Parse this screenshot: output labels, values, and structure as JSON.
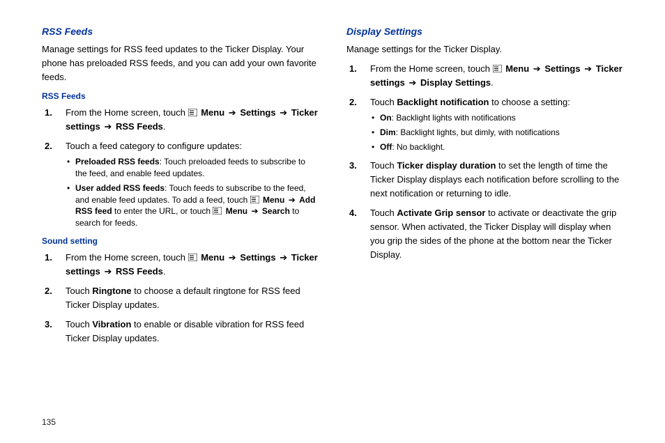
{
  "pageNumber": "135",
  "arrow": "➔",
  "left": {
    "title": "RSS Feeds",
    "intro": "Manage settings for RSS feed updates to the Ticker Display. Your phone has preloaded RSS feeds, and you can add your own favorite feeds.",
    "sub1Title": "RSS Feeds",
    "s1": {
      "num": "1.",
      "pre": "From the Home screen, touch ",
      "path": [
        "Menu",
        "Settings",
        "Ticker settings",
        "RSS Feeds"
      ],
      "dot": "."
    },
    "s2": {
      "num": "2.",
      "text": "Touch a feed category to configure updates:",
      "b1": {
        "bold": "Preloaded RSS feeds",
        "rest": ": Touch preloaded feeds to subscribe to the feed, and enable feed updates."
      },
      "b2": {
        "bold": "User added RSS feeds",
        "t1": ": Touch feeds to subscribe to the feed, and enable feed updates. To add a feed, touch ",
        "p1": [
          "Menu",
          "Add RSS feed"
        ],
        "t2": " to enter the URL, or touch ",
        "p2": [
          "Menu",
          "Search"
        ],
        "t3": " to search for feeds."
      }
    },
    "sub2Title": "Sound setting",
    "ss1": {
      "num": "1.",
      "pre": "From the Home screen, touch ",
      "path": [
        "Menu",
        "Settings",
        "Ticker settings",
        "RSS Feeds"
      ],
      "dot": "."
    },
    "ss2": {
      "num": "2.",
      "t1": "Touch ",
      "b": "Ringtone",
      "t2": " to choose a default ringtone for RSS feed Ticker Display updates."
    },
    "ss3": {
      "num": "3.",
      "t1": "Touch ",
      "b": "Vibration",
      "t2": " to enable or disable vibration for RSS feed Ticker Display updates."
    }
  },
  "right": {
    "title": "Display Settings",
    "intro": "Manage settings for the Ticker Display.",
    "s1": {
      "num": "1.",
      "pre": "From the Home screen, touch ",
      "path": [
        "Menu",
        "Settings",
        "Ticker settings",
        "Display Settings"
      ],
      "dot": "."
    },
    "s2": {
      "num": "2.",
      "t1": "Touch ",
      "b": "Backlight notification",
      "t2": " to choose a setting:",
      "b1": {
        "bold": "On",
        "rest": ": Backlight lights with notifications"
      },
      "b2": {
        "bold": "Dim",
        "rest": ": Backlight lights, but dimly, with notifications"
      },
      "b3": {
        "bold": "Off",
        "rest": ": No backlight."
      }
    },
    "s3": {
      "num": "3.",
      "t1": "Touch ",
      "b": "Ticker display duration",
      "t2": " to set the length of time the Ticker Display displays each notification before scrolling to the next notification or returning to idle."
    },
    "s4": {
      "num": "4.",
      "t1": "Touch ",
      "b": "Activate Grip sensor",
      "t2": " to activate or deactivate the grip sensor. When activated, the Ticker Display will display when you grip the sides of the phone at the bottom near the Ticker Display."
    }
  }
}
